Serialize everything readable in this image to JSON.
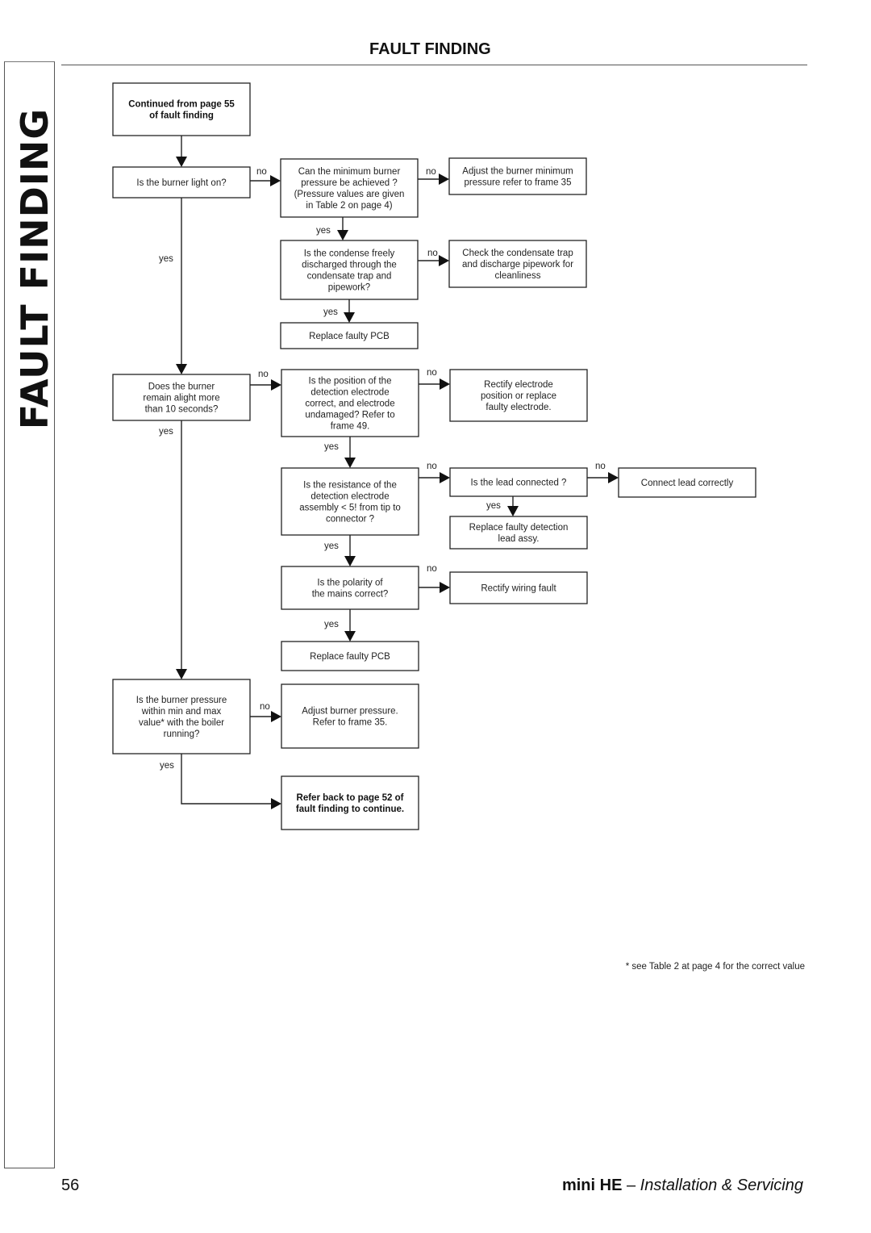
{
  "side_tab": {
    "title": "FAULT FINDING"
  },
  "header": {
    "title": "FAULT FINDING"
  },
  "flowchart": {
    "nodes": [
      {
        "id": "start",
        "lines": [
          "Continued from page 55",
          "of fault finding"
        ],
        "bold": true
      },
      {
        "id": "burner_light",
        "lines": [
          "Is the burner light on?"
        ]
      },
      {
        "id": "min_pressure",
        "lines": [
          "Can the minimum burner",
          "pressure be achieved ?",
          "(Pressure values are given",
          "in Table 2 on page 4)"
        ]
      },
      {
        "id": "adjust_min",
        "lines": [
          "Adjust the burner minimum",
          "pressure refer to frame 35"
        ]
      },
      {
        "id": "condense",
        "lines": [
          "Is the condense freely",
          "discharged through the",
          "condensate trap and",
          "pipework?"
        ]
      },
      {
        "id": "check_trap",
        "lines": [
          "Check the condensate trap",
          "and discharge pipework for",
          "cleanliness"
        ]
      },
      {
        "id": "replace_pcb_1",
        "lines": [
          "Replace faulty PCB"
        ]
      },
      {
        "id": "alight_10s",
        "lines": [
          "Does the burner",
          "remain alight more",
          "than 10 seconds?"
        ]
      },
      {
        "id": "electrode_pos",
        "lines": [
          "Is the position of the",
          "detection electrode",
          "correct, and electrode",
          "undamaged? Refer to",
          "frame 49."
        ]
      },
      {
        "id": "rectify_electrode",
        "lines": [
          "Rectify electrode",
          "position or replace",
          "faulty electrode."
        ]
      },
      {
        "id": "resistance",
        "lines": [
          "Is the resistance of the",
          "detection electrode",
          "assembly < 5!   from tip to",
          "connector ?"
        ]
      },
      {
        "id": "lead_connected",
        "lines": [
          "Is the lead connected ?"
        ]
      },
      {
        "id": "connect_lead",
        "lines": [
          "Connect lead correctly"
        ]
      },
      {
        "id": "replace_lead",
        "lines": [
          "Replace faulty detection",
          "lead assy."
        ]
      },
      {
        "id": "polarity",
        "lines": [
          "Is the polarity of",
          "the mains correct?"
        ]
      },
      {
        "id": "rectify_wiring",
        "lines": [
          "Rectify wiring fault"
        ]
      },
      {
        "id": "replace_pcb_2",
        "lines": [
          "Replace faulty PCB"
        ]
      },
      {
        "id": "burner_pressure",
        "lines": [
          "Is the burner pressure",
          "within min and max",
          "value* with the boiler",
          "running?"
        ]
      },
      {
        "id": "adjust_burner",
        "lines": [
          "Adjust burner pressure.",
          "Refer to frame 35."
        ]
      },
      {
        "id": "refer_back",
        "lines": [
          "Refer back to page 52 of",
          "fault finding to continue."
        ],
        "bold": true
      }
    ],
    "edges": [
      {
        "from": "start",
        "to": "burner_light",
        "label": ""
      },
      {
        "from": "burner_light",
        "to": "min_pressure",
        "label": "no"
      },
      {
        "from": "min_pressure",
        "to": "adjust_min",
        "label": "no"
      },
      {
        "from": "min_pressure",
        "to": "condense",
        "label": "yes"
      },
      {
        "from": "condense",
        "to": "check_trap",
        "label": "no"
      },
      {
        "from": "condense",
        "to": "replace_pcb_1",
        "label": "yes"
      },
      {
        "from": "burner_light",
        "to": "alight_10s",
        "label": "yes"
      },
      {
        "from": "alight_10s",
        "to": "electrode_pos",
        "label": "no"
      },
      {
        "from": "electrode_pos",
        "to": "rectify_electrode",
        "label": "no"
      },
      {
        "from": "electrode_pos",
        "to": "resistance",
        "label": "yes"
      },
      {
        "from": "resistance",
        "to": "lead_connected",
        "label": "no"
      },
      {
        "from": "lead_connected",
        "to": "connect_lead",
        "label": "no"
      },
      {
        "from": "lead_connected",
        "to": "replace_lead",
        "label": "yes"
      },
      {
        "from": "resistance",
        "to": "polarity",
        "label": "yes"
      },
      {
        "from": "polarity",
        "to": "rectify_wiring",
        "label": "no"
      },
      {
        "from": "polarity",
        "to": "replace_pcb_2",
        "label": "yes"
      },
      {
        "from": "alight_10s",
        "to": "burner_pressure",
        "label": "yes"
      },
      {
        "from": "burner_pressure",
        "to": "adjust_burner",
        "label": "no"
      },
      {
        "from": "burner_pressure",
        "to": "refer_back",
        "label": "yes"
      }
    ]
  },
  "footnote": "* see Table 2 at page 4 for the correct value",
  "footer": {
    "page_number": "56",
    "brand": "mini HE",
    "separator": " – ",
    "subtitle": "Installation & Servicing"
  }
}
